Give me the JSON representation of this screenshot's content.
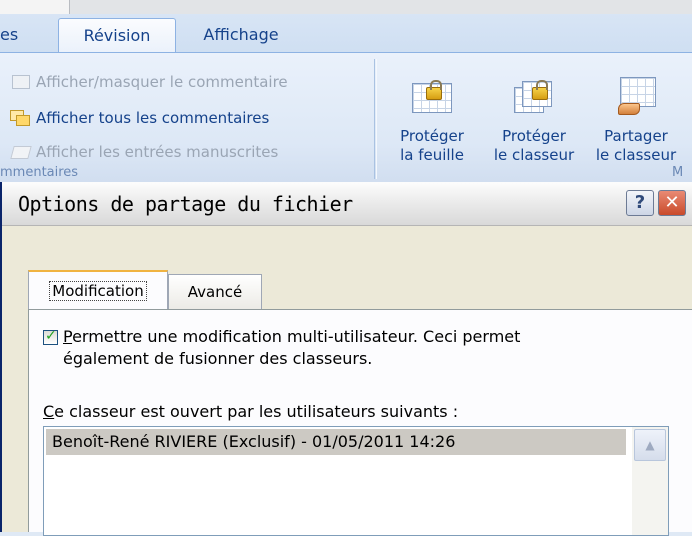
{
  "ribbon": {
    "tabs": [
      {
        "label": "es"
      },
      {
        "label": "Révision"
      },
      {
        "label": "Affichage"
      }
    ],
    "comments_group": {
      "items": [
        {
          "label": "Afficher/masquer le commentaire",
          "icon": "comment-toggle-icon",
          "enabled": false
        },
        {
          "label": "Afficher tous les commentaires",
          "icon": "comments-all-icon",
          "enabled": true
        },
        {
          "label": "Afficher les entrées manuscrites",
          "icon": "ink-icon",
          "enabled": false
        }
      ],
      "label": "mmentaires"
    },
    "changes_group": {
      "buttons": [
        {
          "line1": "Protéger",
          "line2": "la feuille",
          "icon": "protect-sheet-icon"
        },
        {
          "line1": "Protéger",
          "line2": "le classeur",
          "icon": "protect-workbook-icon"
        },
        {
          "line1": "Partager",
          "line2": "le classeur",
          "icon": "share-workbook-icon"
        }
      ],
      "label": "M"
    }
  },
  "dialog": {
    "title": "Options de partage du fichier",
    "help_glyph": "?",
    "close_glyph": "✕",
    "tabs": [
      {
        "label": "Modification"
      },
      {
        "label": "Avancé"
      }
    ],
    "checkbox": {
      "checked": true,
      "label_first_char": "P",
      "label_rest_line1": "ermettre une modification multi-utilisateur. Ceci permet",
      "label_line2": "également de fusionner des classeurs."
    },
    "users_label_first_char": "C",
    "users_label_rest": "e classeur est ouvert par les utilisateurs suivants :",
    "users": [
      "Benoît-René RIVIERE (Exclusif) - 01/05/2011 14:26"
    ],
    "scroll_up_glyph": "▲"
  },
  "colors": {
    "ribbon_text": "#15428b",
    "disabled_text": "#9aa5b4",
    "close_button": "#c94a2a"
  }
}
